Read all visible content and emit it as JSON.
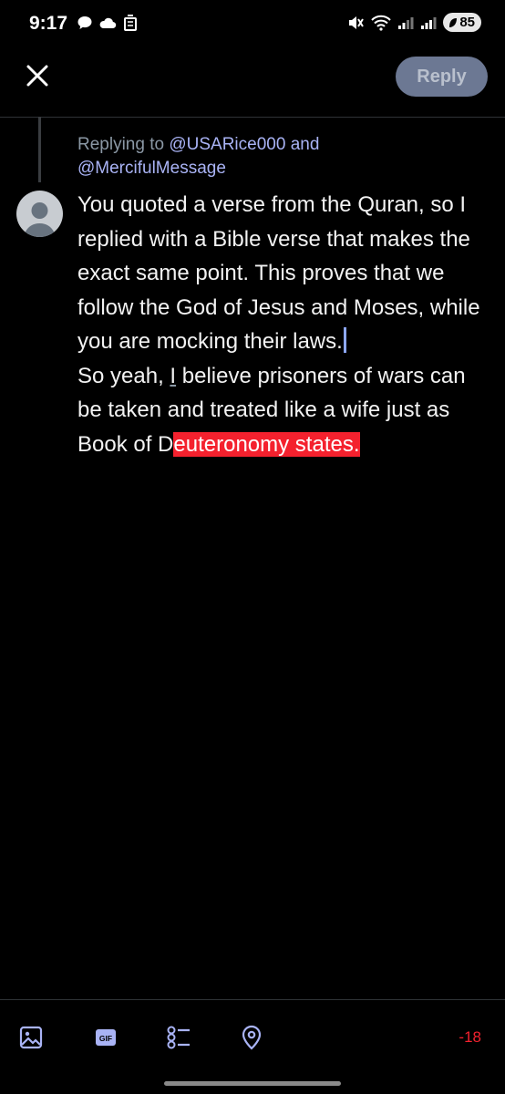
{
  "status_bar": {
    "time": "9:17",
    "battery": "85"
  },
  "header": {
    "reply_label": "Reply"
  },
  "replying": {
    "prefix": "Replying to",
    "handle1": "@USARice000",
    "conj": "and",
    "handle2": "@MercifulMessage"
  },
  "compose": {
    "para1": "You quoted a verse from the Quran, so I replied with a Bible verse that makes the exact same point. This proves that we follow the God of Jesus and Moses, while you are mocking their laws.",
    "para2_a": "So yeah, ",
    "para2_i": "I",
    "para2_b": " believe prisoners of wars can be taken and treated like a wife just as Book of D",
    "para2_over": "euteronomy states."
  },
  "toolbar": {
    "char_count": "-18",
    "icons": [
      "image-icon",
      "gif-icon",
      "poll-icon",
      "location-icon"
    ]
  },
  "colors": {
    "accent": "#a9b3f5",
    "reply_disabled": "#6c7893",
    "over_limit": "#f4212e"
  }
}
